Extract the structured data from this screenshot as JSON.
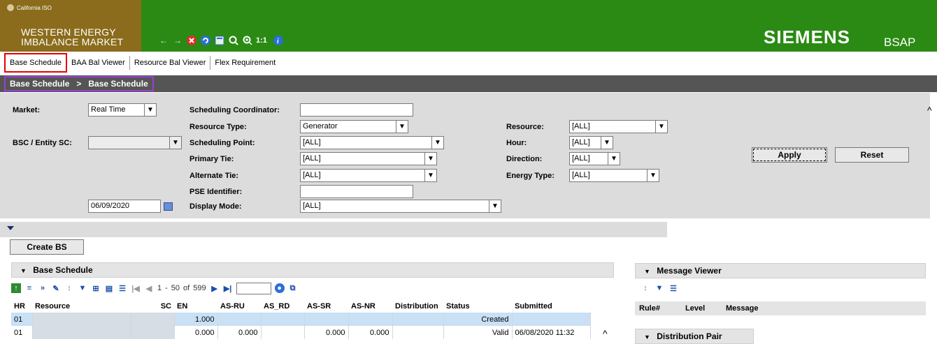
{
  "header": {
    "org": "California ISO",
    "brand_line1": "WESTERN ENERGY",
    "brand_line2": "IMBALANCE MARKET",
    "toolbar_zoom_label": "1:1",
    "vendor": "SIEMENS",
    "app": "BSAP",
    "colors": {
      "header_bg": "#2b8a14",
      "brand_bg": "#8b6c1c"
    }
  },
  "nav": {
    "items": [
      {
        "label": "Base Schedule"
      },
      {
        "label": "BAA Bal Viewer"
      },
      {
        "label": "Resource Bal Viewer"
      },
      {
        "label": "Flex Requirement"
      }
    ]
  },
  "breadcrumb": {
    "part1": "Base Schedule",
    "sep": ">",
    "part2": "Base Schedule"
  },
  "filters": {
    "market_label": "Market:",
    "market_value": "Real Time",
    "bsc_label": "BSC / Entity SC:",
    "bsc_value": "",
    "date_value": "06/09/2020",
    "sc_label": "Scheduling Coordinator:",
    "sc_value": "",
    "resource_type_label": "Resource Type:",
    "resource_type_value": "Generator",
    "scheduling_point_label": "Scheduling Point:",
    "scheduling_point_value": "[ALL]",
    "primary_tie_label": "Primary Tie:",
    "primary_tie_value": "[ALL]",
    "alternate_tie_label": "Alternate Tie:",
    "alternate_tie_value": "[ALL]",
    "pse_label": "PSE Identifier:",
    "pse_value": "",
    "display_mode_label": "Display Mode:",
    "display_mode_value": "[ALL]",
    "resource_label": "Resource:",
    "resource_value": "[ALL]",
    "hour_label": "Hour:",
    "hour_value": "[ALL]",
    "direction_label": "Direction:",
    "direction_value": "[ALL]",
    "energy_type_label": "Energy Type:",
    "energy_type_value": "[ALL]",
    "apply_label": "Apply",
    "reset_label": "Reset"
  },
  "create_bs_label": "Create BS",
  "base_schedule": {
    "title": "Base Schedule",
    "pager": {
      "from": "1",
      "dash": "-",
      "to": "50",
      "of_label": "of",
      "total": "599"
    },
    "columns": [
      "HR",
      "Resource",
      "SC",
      "EN",
      "AS-RU",
      "AS_RD",
      "AS-SR",
      "AS-NR",
      "Distribution",
      "Status",
      "Submitted"
    ],
    "rows": [
      {
        "hr": "01",
        "resource": "",
        "sc": "",
        "en": "1.000",
        "as_ru": "",
        "as_rd": "",
        "as_sr": "",
        "as_nr": "",
        "distribution": "",
        "status": "Created",
        "submitted": ""
      },
      {
        "hr": "01",
        "resource": "",
        "sc": "",
        "en": "0.000",
        "as_ru": "0.000",
        "as_rd": "",
        "as_sr": "0.000",
        "as_nr": "0.000",
        "distribution": "",
        "status": "Valid",
        "submitted": "06/08/2020 11:32"
      }
    ]
  },
  "message_viewer": {
    "title": "Message Viewer",
    "columns": [
      "Rule#",
      "Level",
      "Message"
    ]
  },
  "distribution_pair": {
    "title": "Distribution Pair"
  }
}
